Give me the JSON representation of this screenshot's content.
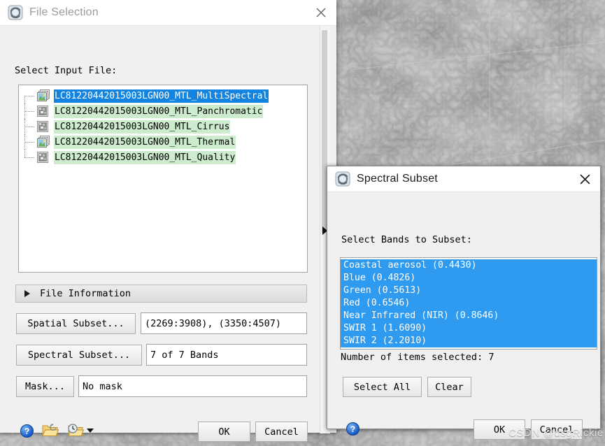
{
  "background": {
    "name": "landsat-grayscale-scene",
    "watermark": "CSDN @dsgRickie"
  },
  "file_selection_dialog": {
    "title": "File Selection",
    "icon": "envi-app-icon",
    "close_icon": "close-icon",
    "label_select_input": "Select Input File:",
    "files": [
      {
        "name": "LC81220442015003LGN00_MTL_MultiSpectral",
        "icon": "multispectral-file-icon",
        "selected": true
      },
      {
        "name": "LC81220442015003LGN00_MTL_Panchromatic",
        "icon": "grayscale-file-icon",
        "selected": false
      },
      {
        "name": "LC81220442015003LGN00_MTL_Cirrus",
        "icon": "grayscale-file-icon",
        "selected": false
      },
      {
        "name": "LC81220442015003LGN00_MTL_Thermal",
        "icon": "multispectral-file-icon",
        "selected": false
      },
      {
        "name": "LC81220442015003LGN00_MTL_Quality",
        "icon": "grayscale-file-icon",
        "selected": false
      }
    ],
    "file_information": {
      "label": "File Information",
      "expander_icon": "triangle-right-icon",
      "expanded": false
    },
    "rows": [
      {
        "button": "Spatial Subset...",
        "value": "(2269:3908), (3350:4507)"
      },
      {
        "button": "Spectral Subset...",
        "value": "7 of 7 Bands"
      },
      {
        "button": "Mask...",
        "value": "No mask"
      }
    ],
    "toolbar": [
      {
        "label": "?",
        "icon": "help-icon"
      },
      {
        "label": "",
        "icon": "open-folder-icon"
      },
      {
        "label": "",
        "icon": "recent-files-icon"
      }
    ],
    "ok_label": "OK",
    "cancel_label": "Cancel",
    "splitter_icon": "collapse-arrow-icon"
  },
  "spectral_subset_dialog": {
    "title": "Spectral Subset",
    "icon": "envi-app-icon",
    "close_icon": "close-icon",
    "label_select_bands": "Select Bands to Subset:",
    "bands": [
      {
        "name": "Coastal aerosol (0.4430)",
        "selected": true
      },
      {
        "name": "Blue (0.4826)",
        "selected": true
      },
      {
        "name": "Green (0.5613)",
        "selected": true
      },
      {
        "name": "Red (0.6546)",
        "selected": true
      },
      {
        "name": "Near Infrared (NIR) (0.8646)",
        "selected": true
      },
      {
        "name": "SWIR 1 (1.6090)",
        "selected": true
      },
      {
        "name": "SWIR 2 (2.2010)",
        "selected": true
      }
    ],
    "count_label": "Number of items selected: 7",
    "select_all_label": "Select All",
    "clear_label": "Clear",
    "help_label": "?",
    "ok_label": "OK",
    "cancel_label": "Cancel"
  },
  "colors": {
    "selection_blue": "#1384e0",
    "band_selection_blue": "#2e9bf0",
    "file_row_green": "#cdeccd",
    "dialog_gray": "#f0f0f0"
  }
}
